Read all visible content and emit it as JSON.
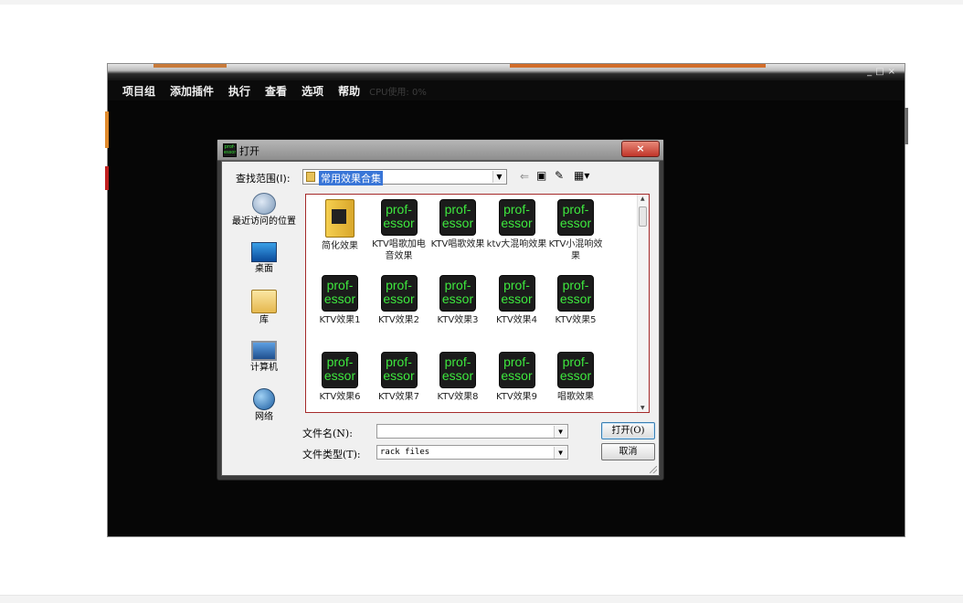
{
  "app": {
    "menu": [
      "项目组",
      "添加插件",
      "执行",
      "查看",
      "选项",
      "帮助"
    ],
    "cpu_label": "CPU使用: 0%",
    "window_controls": [
      "_",
      "□",
      "×"
    ]
  },
  "dialog": {
    "title": "打开",
    "close_label": "×",
    "app_icon_text": "prof-essor",
    "lookin_label": "查找范围(I):",
    "lookin_value": "常用效果合集",
    "toolbar_icons": [
      "back-arrow-icon",
      "up-folder-icon",
      "new-folder-icon",
      "view-menu-icon"
    ],
    "places": [
      {
        "label": "最近访问的位置",
        "icon": "recent-places-icon"
      },
      {
        "label": "桌面",
        "icon": "desktop-icon"
      },
      {
        "label": "库",
        "icon": "libraries-icon"
      },
      {
        "label": "计算机",
        "icon": "computer-icon"
      },
      {
        "label": "网络",
        "icon": "network-icon"
      }
    ],
    "files": [
      {
        "name": "简化效果",
        "type": "folder"
      },
      {
        "name": "KTV唱歌加电音效果",
        "type": "preset"
      },
      {
        "name": "KTV唱歌效果",
        "type": "preset"
      },
      {
        "name": "ktv大混响效果",
        "type": "preset"
      },
      {
        "name": "KTV小混响效果",
        "type": "preset"
      },
      {
        "name": "KTV效果1",
        "type": "preset"
      },
      {
        "name": "KTV效果2",
        "type": "preset"
      },
      {
        "name": "KTV效果3",
        "type": "preset"
      },
      {
        "name": "KTV效果4",
        "type": "preset"
      },
      {
        "name": "KTV效果5",
        "type": "preset"
      },
      {
        "name": "KTV效果6",
        "type": "preset"
      },
      {
        "name": "KTV效果7",
        "type": "preset"
      },
      {
        "name": "KTV效果8",
        "type": "preset"
      },
      {
        "name": "KTV效果9",
        "type": "preset"
      },
      {
        "name": "唱歌效果",
        "type": "preset"
      }
    ],
    "preset_icon_text": [
      "prof-",
      "essor"
    ],
    "filename_label": "文件名(N):",
    "filename_value": "",
    "filetype_label": "文件类型(T):",
    "filetype_value": "rack files",
    "open_button": "打开(O)",
    "cancel_button": "取消"
  },
  "colors": {
    "file_list_border": "#a52a2a",
    "preset_icon_text": "#3ee83e",
    "selection": "#3875d7"
  }
}
